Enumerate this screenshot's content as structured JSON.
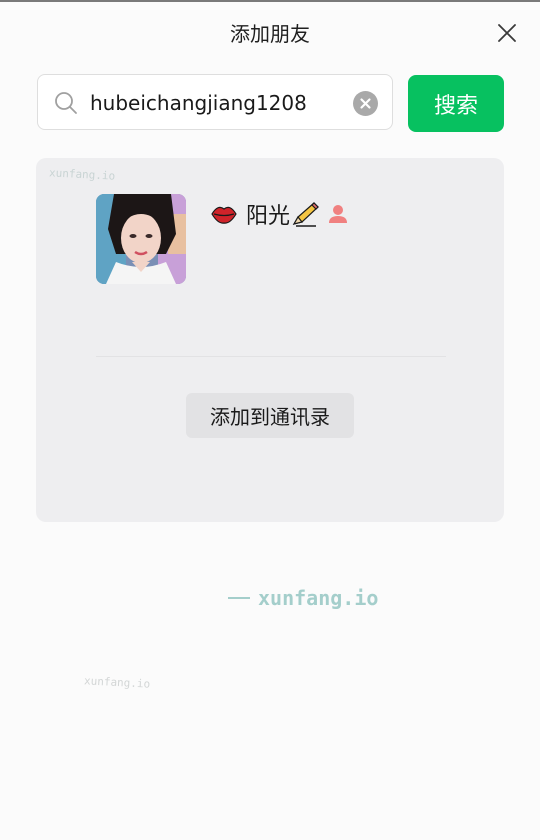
{
  "dialog": {
    "title": "添加朋友"
  },
  "search": {
    "value": "hubeichangjiang1208",
    "button_label": "搜索"
  },
  "result": {
    "nickname": "阳光",
    "add_button_label": "添加到通讯录"
  },
  "watermarks": {
    "card": "xunfang.io",
    "main": "xunfang.io",
    "faint": "xunfang.io"
  },
  "colors": {
    "accent": "#07c160",
    "card_bg": "#eeeef0",
    "page_bg": "#fbfbfb",
    "gender_icon": "#f08080"
  },
  "icons": {
    "close": "close-icon",
    "search": "search-icon",
    "clear": "clear-icon",
    "name_prefix": "lips-icon",
    "name_suffix": "pencil-icon",
    "gender": "female-icon"
  }
}
